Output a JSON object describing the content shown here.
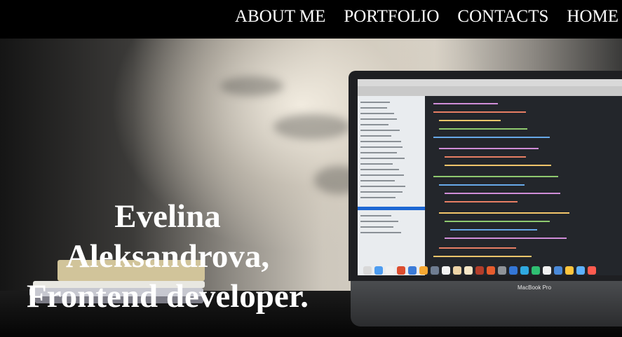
{
  "nav": {
    "items": [
      {
        "label": "ABOUT ME"
      },
      {
        "label": "PORTFOLIO"
      },
      {
        "label": "CONTACTS"
      },
      {
        "label": "HOME"
      }
    ]
  },
  "hero": {
    "title_line1": "Evelina",
    "title_line2": "Aleksandrova,",
    "title_line3": "Frontend developer.",
    "background_image_label": "MacBook Pro"
  },
  "colors": {
    "navbar": "#000000",
    "text": "#ffffff"
  }
}
